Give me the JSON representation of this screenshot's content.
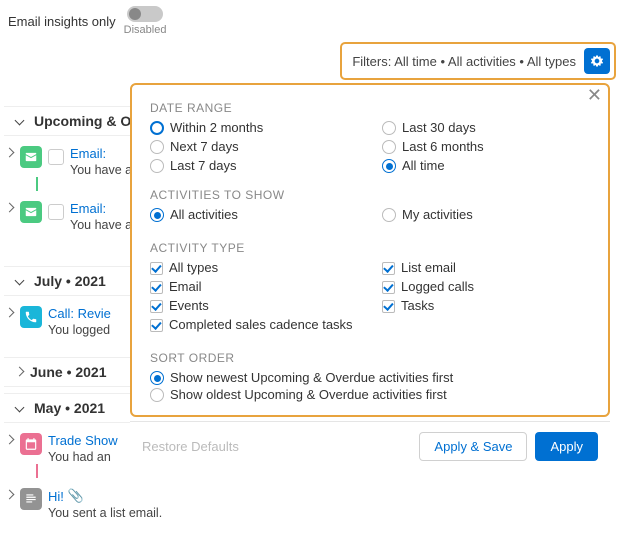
{
  "toggle": {
    "label": "Email insights only",
    "state": "Disabled"
  },
  "filter_bar": {
    "text": "Filters: All time • All activities • All types"
  },
  "timeline": {
    "groups": [
      {
        "title": "Upcoming & O"
      },
      {
        "title": "July • 2021"
      },
      {
        "title": "June • 2021"
      },
      {
        "title": "May • 2021"
      }
    ],
    "items": {
      "email1": {
        "title": "Email:",
        "sub": "You have an"
      },
      "email2": {
        "title": "Email:",
        "sub": "You have an"
      },
      "call": {
        "title": "Call: Revie",
        "sub": "You logged"
      },
      "trade": {
        "title": "Trade Show",
        "sub": "You had an"
      },
      "hi": {
        "title": "Hi!",
        "sub": "You sent a list email."
      }
    }
  },
  "panel": {
    "date_range": {
      "heading": "DATE RANGE",
      "left": [
        "Within 2 months",
        "Next 7 days",
        "Last 7 days"
      ],
      "right": [
        "Last 30 days",
        "Last 6 months",
        "All time"
      ],
      "selected": "All time",
      "highlighted": "Within 2 months"
    },
    "activities": {
      "heading": "ACTIVITIES TO SHOW",
      "left": "All activities",
      "right": "My activities",
      "selected": "All activities"
    },
    "activity_type": {
      "heading": "ACTIVITY TYPE",
      "left": [
        "All types",
        "Email",
        "Events",
        "Completed sales cadence tasks"
      ],
      "right": [
        "List email",
        "Logged calls",
        "Tasks"
      ]
    },
    "sort": {
      "heading": "SORT ORDER",
      "opt1": "Show newest Upcoming & Overdue activities first",
      "opt2": "Show oldest Upcoming & Overdue activities first",
      "selected": 0
    },
    "footer": {
      "restore": "Restore Defaults",
      "apply_save": "Apply & Save",
      "apply": "Apply"
    }
  }
}
